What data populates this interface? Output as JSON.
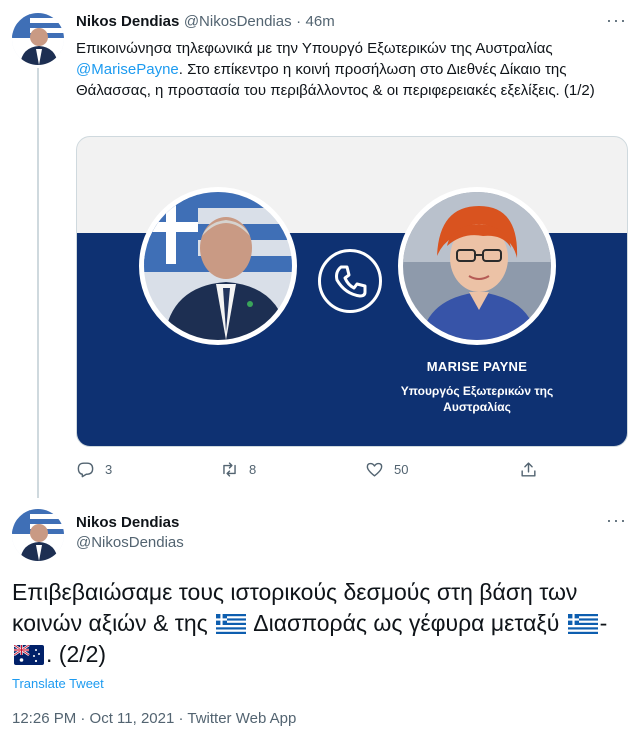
{
  "tweet1": {
    "author_name": "Nikos Dendias",
    "author_handle": "@NikosDendias",
    "separator": "·",
    "time_ago": "46m",
    "text_part1": "Επικοινώνησα τηλεφωνικά με την Υπουργό Εξωτερικών της Αυστραλίας ",
    "mention": "@MarisePayne",
    "text_part2": ". Στο επίκεντρο η κοινή προσήλωση στο Διεθνές Δίκαιο της Θάλασσας, η προστασία του περιβάλλοντος & οι περιφερειακές εξελίξεις. (1/2)",
    "card": {
      "name": "MARISE PAYNE",
      "role": "Υπουργός Εξωτερικών της Αυστραλίας"
    },
    "actions": {
      "reply_icon": "reply-icon",
      "reply_count": "3",
      "retweet_icon": "retweet-icon",
      "retweet_count": "8",
      "like_icon": "heart-icon",
      "like_count": "50",
      "share_icon": "share-icon"
    }
  },
  "tweet2": {
    "author_name": "Nikos Dendias",
    "author_handle": "@NikosDendias",
    "text_part1": "Επιβεβαιώσαμε τους ιστορικούς δεσμούς στη βάση των κοινών αξιών & της ",
    "text_part2": " Διασποράς ως γέφυρα μεταξύ ",
    "text_part3": "- ",
    "text_part4": ". (2/2)",
    "translate_label": "Translate Tweet",
    "timestamp": "12:26 PM · Oct 11, 2021 · Twitter Web App"
  },
  "colors": {
    "accent": "#1d9bf0",
    "muted": "#536471",
    "card_band": "#0e3172"
  }
}
